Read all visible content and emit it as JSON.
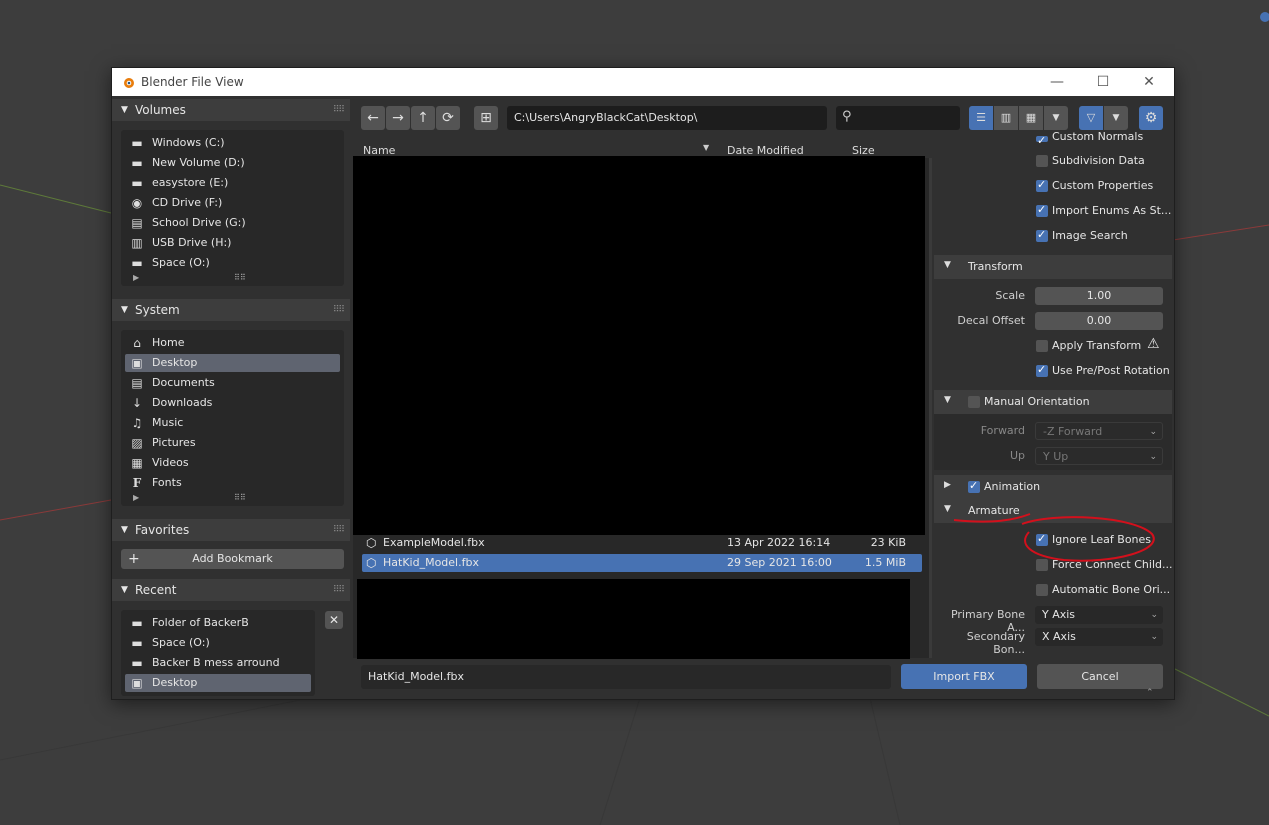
{
  "window": {
    "title": "Blender File View",
    "min": "—",
    "max": "☐",
    "close": "✕"
  },
  "volumes": {
    "header": "Volumes",
    "items": [
      {
        "label": "Windows (C:)",
        "icon": "disk-icon"
      },
      {
        "label": "New Volume (D:)",
        "icon": "disk-icon"
      },
      {
        "label": "easystore (E:)",
        "icon": "disk-icon"
      },
      {
        "label": "CD Drive (F:)",
        "icon": "cd-icon"
      },
      {
        "label": "School Drive (G:)",
        "icon": "network-drive-icon"
      },
      {
        "label": "USB Drive (H:)",
        "icon": "usb-icon"
      },
      {
        "label": "Space (O:)",
        "icon": "disk-icon"
      }
    ]
  },
  "system": {
    "header": "System",
    "items": [
      {
        "label": "Home",
        "icon": "home-icon"
      },
      {
        "label": "Desktop",
        "icon": "desktop-icon",
        "selected": true
      },
      {
        "label": "Documents",
        "icon": "documents-icon"
      },
      {
        "label": "Downloads",
        "icon": "download-icon"
      },
      {
        "label": "Music",
        "icon": "music-icon"
      },
      {
        "label": "Pictures",
        "icon": "image-icon"
      },
      {
        "label": "Videos",
        "icon": "video-icon"
      },
      {
        "label": "Fonts",
        "icon": "font-icon"
      }
    ]
  },
  "favorites": {
    "header": "Favorites",
    "add_bookmark": "Add Bookmark"
  },
  "recent": {
    "header": "Recent",
    "items": [
      {
        "label": "Folder of BackerB",
        "icon": "folder-icon"
      },
      {
        "label": "Space (O:)",
        "icon": "disk-icon"
      },
      {
        "label": "Backer B mess arround",
        "icon": "folder-icon"
      },
      {
        "label": "Desktop",
        "icon": "desktop-icon",
        "selected": true
      }
    ]
  },
  "toolbar": {
    "path": "C:\\Users\\AngryBlackCat\\Desktop\\",
    "search_placeholder": ""
  },
  "file_list": {
    "columns": {
      "name": "Name",
      "date": "Date Modified",
      "size": "Size"
    },
    "rows": [
      {
        "name": "ExampleModel.fbx",
        "date": "13 Apr 2022 16:14",
        "size": "23 KiB"
      },
      {
        "name": "HatKid_Model.fbx",
        "date": "29 Sep 2021 16:00",
        "size": "1.5 MiB",
        "selected": true
      }
    ]
  },
  "filename_field": "HatKid_Model.fbx",
  "buttons": {
    "import": "Import FBX",
    "cancel": "Cancel"
  },
  "props": {
    "cut_top": "Custom Normals",
    "subdivision": "Subdivision Data",
    "custom_props": "Custom Properties",
    "import_enums": "Import Enums As St...",
    "image_search": "Image Search",
    "transform": {
      "header": "Transform",
      "scale_label": "Scale",
      "scale_value": "1.00",
      "decal_label": "Decal Offset",
      "decal_value": "0.00",
      "apply_transform": "Apply Transform",
      "use_prepost": "Use Pre/Post Rotation"
    },
    "manual_orientation": {
      "header": "Manual Orientation",
      "forward_label": "Forward",
      "forward_value": "-Z Forward",
      "up_label": "Up",
      "up_value": "Y Up"
    },
    "animation": {
      "header": "Animation"
    },
    "armature": {
      "header": "Armature",
      "ignore_leaf": "Ignore Leaf Bones",
      "force_connect": "Force Connect Child...",
      "auto_bone": "Automatic Bone Ori...",
      "primary_label": "Primary Bone A...",
      "primary_value": "Y Axis",
      "secondary_label": "Secondary Bon...",
      "secondary_value": "X Axis"
    }
  },
  "colors": {
    "accent": "#4772b3",
    "annotation": "#d3101c"
  }
}
